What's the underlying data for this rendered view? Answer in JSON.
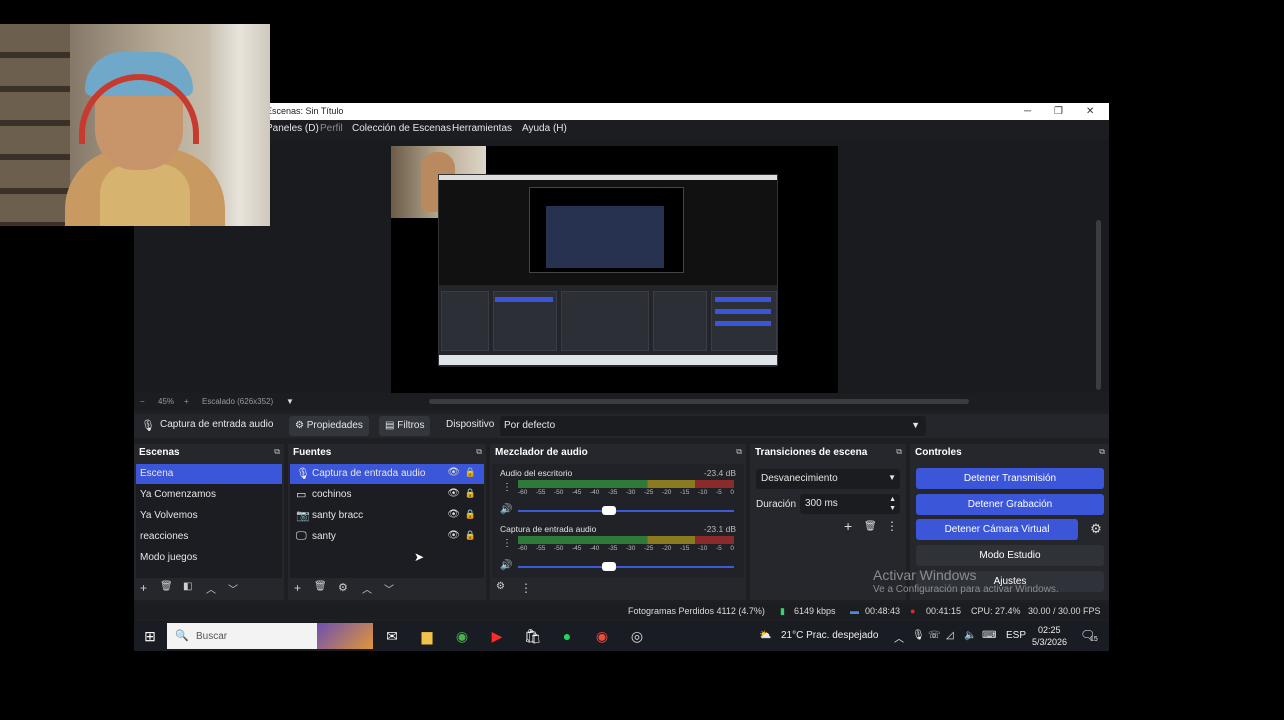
{
  "window": {
    "title": "Escenas: Sin Título"
  },
  "menu": [
    "Paneles (D)",
    "Perfil",
    "Colección de Escenas",
    "Herramientas",
    "Ayuda (H)"
  ],
  "zoom": {
    "minus": "−",
    "value": "45%",
    "plus": "+",
    "scale_label": "Escalado (626x352)"
  },
  "source_toolbar": {
    "source_name": "Captura de entrada audio",
    "properties_label": "Propiedades",
    "filters_label": "Filtros",
    "device_label": "Dispositivo",
    "device_value": "Por defecto"
  },
  "scenes": {
    "title": "Escenas",
    "items": [
      "Escena",
      "Ya Comenzamos",
      "Ya Volvemos",
      "reacciones",
      "Modo juegos"
    ],
    "selected": "Escena"
  },
  "sources": {
    "title": "Fuentes",
    "items": [
      {
        "label": "Captura de entrada audio",
        "icon": "microphone-icon",
        "selected": true
      },
      {
        "label": "cochinos",
        "icon": "window-icon",
        "selected": false
      },
      {
        "label": "santy bracc",
        "icon": "camera-icon",
        "selected": false
      },
      {
        "label": "santy",
        "icon": "monitor-icon",
        "selected": false
      }
    ]
  },
  "mixer": {
    "title": "Mezclador de audio",
    "scale": [
      "-60",
      "-55",
      "-50",
      "-45",
      "-40",
      "-35",
      "-30",
      "-25",
      "-20",
      "-15",
      "-10",
      "-5",
      "0"
    ],
    "channels": [
      {
        "name": "Audio del escritorio",
        "db": "-23.4 dB",
        "level": 0.5
      },
      {
        "name": "Captura de entrada audio",
        "db": "-23.1 dB",
        "level": 0.5
      }
    ]
  },
  "transitions": {
    "title": "Transiciones de escena",
    "type": "Desvanecimiento",
    "duration_label": "Duración",
    "duration_value": "300 ms"
  },
  "controls": {
    "title": "Controles",
    "stop_stream": "Detener Transmisión",
    "stop_recording": "Detener Grabación",
    "stop_virtualcam": "Detener Cámara Virtual",
    "studio_mode": "Modo Estudio",
    "settings": "Ajustes"
  },
  "status": {
    "dropped_frames": "Fotogramas Perdidos 4112 (4.7%)",
    "bitrate": "6149 kbps",
    "stream_time": "00:48:43",
    "rec_time": "00:41:15",
    "cpu": "CPU: 27.4%",
    "fps": "30.00 / 30.00 FPS"
  },
  "activation": {
    "line1": "Activar Windows",
    "line2": "Ve a Configuración para activar Windows."
  },
  "taskbar": {
    "search_placeholder": "Buscar",
    "weather": "21°C  Prac. despejado",
    "language": "ESP",
    "time": "02:25",
    "date": "5/3/2026",
    "notifications": "15"
  },
  "colors": {
    "accent": "#3c56d9",
    "panel": "#25272d",
    "background": "#1e1f23"
  }
}
